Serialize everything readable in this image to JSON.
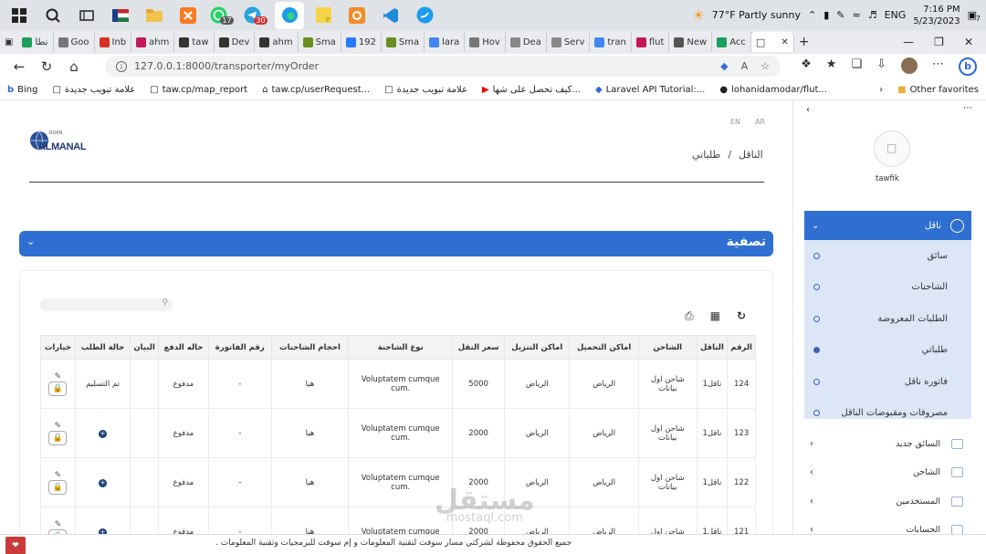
{
  "taskbar": {
    "badges": {
      "whatsapp": "17",
      "telegram": "30"
    },
    "weather": "77°F  Partly sunny",
    "lang": "ENG",
    "time": "7:16 PM",
    "date": "5/23/2023",
    "notif": "7"
  },
  "tabs": [
    {
      "label": "نطا",
      "color": "#1c9e5c"
    },
    {
      "label": "Goo",
      "color": "#777"
    },
    {
      "label": "Inb",
      "color": "#d93025"
    },
    {
      "label": "ahm",
      "color": "#c2185b"
    },
    {
      "label": "taw",
      "color": "#333"
    },
    {
      "label": "Dev",
      "color": "#333"
    },
    {
      "label": "ahm",
      "color": "#333"
    },
    {
      "label": "Sma",
      "color": "#6b8e23"
    },
    {
      "label": "192",
      "color": "#2979ff"
    },
    {
      "label": "Sma",
      "color": "#6b8e23"
    },
    {
      "label": "lara",
      "color": "#4285f4"
    },
    {
      "label": "Hov",
      "color": "#777"
    },
    {
      "label": "Dea",
      "color": "#888"
    },
    {
      "label": "Serv",
      "color": "#888"
    },
    {
      "label": "tran",
      "color": "#4285f4"
    },
    {
      "label": "flut",
      "color": "#c2185b"
    },
    {
      "label": "New",
      "color": "#555"
    },
    {
      "label": "Acc",
      "color": "#1c9e5c"
    }
  ],
  "address": {
    "url": "127.0.0.1:8000/transporter/myOrder"
  },
  "bookmarks": [
    "Bing",
    "علامة تبويب جديدة",
    "taw.cp/map_report",
    "taw.cp/userRequest...",
    "علامة تبويب جديدة",
    "كيف تحصل على شها...",
    "Laravel API Tutorial:...",
    "lohanidamodar/flut...",
    "Other favorites"
  ],
  "header": {
    "lang_en": "EN",
    "lang_ar": "AR",
    "logo_small": "ROKN",
    "logo": "ALMANAL",
    "breadcrumb_root": "الناقل",
    "breadcrumb_sep": "/",
    "breadcrumb_current": "طلباتي"
  },
  "filter": {
    "title": "تصفية"
  },
  "table": {
    "headers": [
      "الرقم",
      "الناقل",
      "الشاحن",
      "اماكن التحميل",
      "اماكن التنزيل",
      "سعر النقل",
      "نوع الشاحنة",
      "احجام الشاحنات",
      "رقم الفاتورة",
      "حاله الدفع",
      "البيان",
      "حالة الطلب",
      "خيارات"
    ],
    "rows": [
      {
        "id": "124",
        "carrier": "ناقل1",
        "shipper": "شاحن اول بيانات",
        "load": "الرياض",
        "unload": "الرياض",
        "price": "5000",
        "truck": "Voluptatem cumque cum.",
        "size": "هيا",
        "invoice": "-",
        "payment": "مدفوع",
        "note": "",
        "status": "تم التسليم"
      },
      {
        "id": "123",
        "carrier": "ناقل1",
        "shipper": "شاحن اول بيانات",
        "load": "الرياض",
        "unload": "الرياض",
        "price": "2000",
        "truck": "Voluptatem cumque cum.",
        "size": "هيا",
        "invoice": "-",
        "payment": "مدفوع",
        "note": "",
        "status": ""
      },
      {
        "id": "122",
        "carrier": "ناقل1",
        "shipper": "شاحن اول بيانات",
        "load": "الرياض",
        "unload": "الرياض",
        "price": "2000",
        "truck": "Voluptatem cumque cum.",
        "size": "هيا",
        "invoice": "-",
        "payment": "مدفوع",
        "note": "",
        "status": ""
      },
      {
        "id": "121",
        "carrier": "ناقل1",
        "shipper": "شاحن اول",
        "load": "الرياض",
        "unload": "الرياض",
        "price": "2000",
        "truck": "Voluptatem cumque",
        "size": "هيا",
        "invoice": "-",
        "payment": "مدفوع",
        "note": "",
        "status": ""
      }
    ]
  },
  "sidebar": {
    "username": "tawfik",
    "group_label": "ناقل",
    "sub_items": [
      "سائق",
      "الشاحنات",
      "الطلبات المعروضة",
      "طلباتي",
      "فاتوره ناقل",
      "مصروفات ومقبوضات الناقل"
    ],
    "items": [
      "السائق جديد",
      "الشاحن",
      "المستخدمين",
      "الحسابات"
    ]
  },
  "footer": {
    "text": "جميع الحقوق محفوظة لشركتي مسار سوفت لتقنية المعلومات و إم سوفت للبرمجيات وتقنية المعلومات ."
  },
  "watermark": {
    "ar": "مستقل",
    "en": "mostaql.com"
  },
  "colors": {
    "primary": "#2f6fd1",
    "sidebar_active": "#dce6f7",
    "accent": "#3c62b6"
  }
}
